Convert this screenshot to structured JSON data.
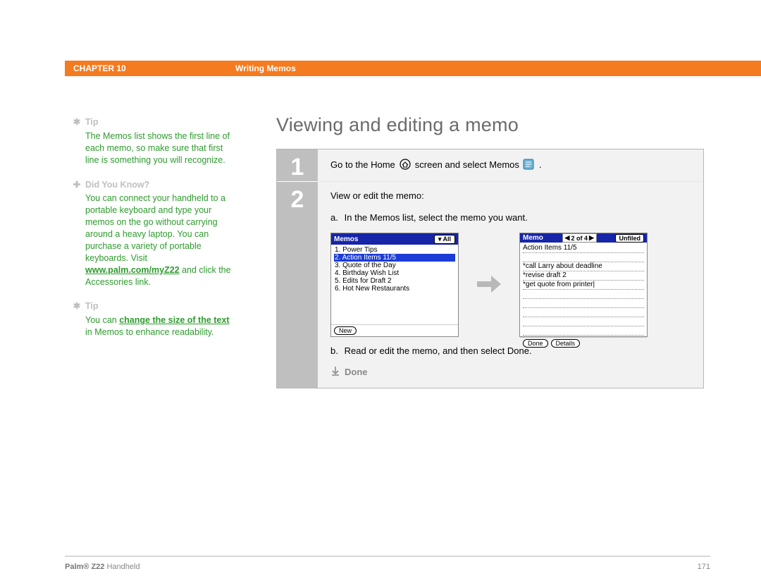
{
  "header": {
    "chapter": "CHAPTER 10",
    "section": "Writing Memos"
  },
  "sidebar": {
    "blocks": [
      {
        "icon": "✱",
        "heading": "Tip",
        "body_plain": "The Memos list shows the first line of each memo, so make sure that first line is something you will recognize."
      },
      {
        "icon": "✚",
        "heading": "Did You Know?",
        "body_pre": "You can connect your handheld to a portable keyboard and type your memos on the go without carrying around a heavy laptop. You can purchase a variety of portable keyboards. Visit ",
        "link": "www.palm.com/myZ22",
        "body_post": " and click the Accessories link."
      },
      {
        "icon": "✱",
        "heading": "Tip",
        "body_pre": "You can ",
        "link": "change the size of the text",
        "body_post": " in Memos to enhance readability."
      }
    ]
  },
  "main": {
    "title": "Viewing and editing a memo",
    "steps": [
      {
        "num": "1",
        "text_pre": "Go to the Home ",
        "text_mid": " screen and select Memos ",
        "text_post": " ."
      },
      {
        "num": "2",
        "intro": "View or edit the memo:",
        "sub_a_label": "a.",
        "sub_a_text": "In the Memos list, select the memo you want.",
        "sub_b_label": "b.",
        "sub_b_text": "Read or edit the memo, and then select Done.",
        "done_label": "Done"
      }
    ],
    "memos_screen": {
      "title": "Memos",
      "category": "▾ All",
      "items": [
        "1. Power Tips",
        "2. Action Items 11/5",
        "3. Quote of the Day",
        "4. Birthday Wish List",
        "5. Edits for Draft 2",
        "6. Hot New Restaurants"
      ],
      "selected_index": 1,
      "new_btn": "New"
    },
    "memo_screen": {
      "title": "Memo",
      "counter": "2 of 4",
      "category": "Unfiled",
      "lines": [
        "Action Items 11/5",
        "",
        "*call Larry about deadline",
        "*revise draft 2",
        "*get quote from printer|",
        "",
        "",
        "",
        "",
        ""
      ],
      "done_btn": "Done",
      "details_btn": "Details"
    }
  },
  "footer": {
    "product_bold": "Palm® Z22",
    "product_rest": " Handheld",
    "page": "171"
  }
}
